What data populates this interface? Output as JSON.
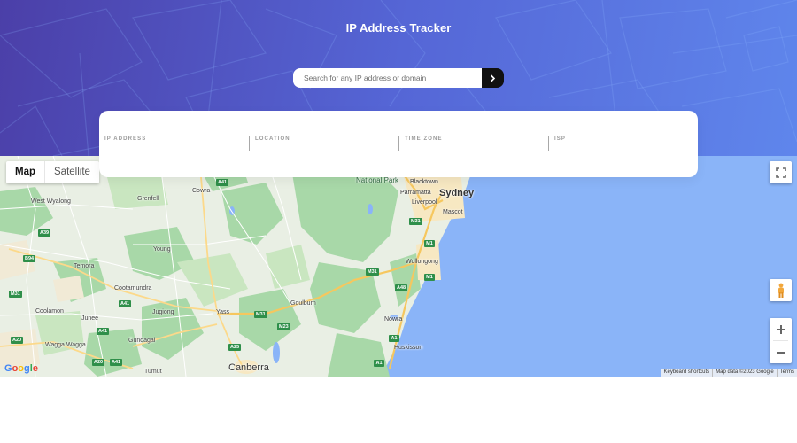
{
  "header": {
    "title": "IP Address Tracker"
  },
  "search": {
    "placeholder": "Search for any IP address or domain",
    "value": ""
  },
  "info": {
    "fields": [
      {
        "label": "IP ADDRESS",
        "value": ""
      },
      {
        "label": "LOCATION",
        "value": ""
      },
      {
        "label": "TIME ZONE",
        "value": ""
      },
      {
        "label": "ISP",
        "value": ""
      }
    ]
  },
  "map": {
    "type_control": {
      "map": "Map",
      "satellite": "Satellite",
      "selected": "Map"
    },
    "labels": {
      "national_park": "National Park",
      "blacktown": "Blacktown",
      "parramatta": "Parramatta",
      "sydney": "Sydney",
      "liverpool": "Liverpool",
      "mascot": "Mascot",
      "cowra": "Cowra",
      "west_wyalong": "West Wyalong",
      "grenfell": "Grenfell",
      "young": "Young",
      "temora": "Temora",
      "cootamundra": "Cootamundra",
      "coolamon": "Coolamon",
      "junee": "Junee",
      "jugiong": "Jugiong",
      "yass": "Yass",
      "goulburn": "Goulburn",
      "wagga_wagga": "Wagga Wagga",
      "gundagai": "Gundagai",
      "tumut": "Tumut",
      "canberra": "Canberra",
      "wollongong": "Wollongong",
      "nowra": "Nowra",
      "huskisson": "Huskisson"
    },
    "shields": [
      "A41",
      "M31",
      "M1",
      "M1",
      "M31",
      "A48",
      "M31",
      "M23",
      "A25",
      "A41",
      "A39",
      "B94",
      "A20",
      "A41",
      "A1",
      "A1",
      "M31",
      "A20",
      "A41"
    ],
    "attribution": {
      "shortcuts": "Keyboard shortcuts",
      "data": "Map data ©2023 Google",
      "terms": "Terms"
    },
    "logo": "Google",
    "colors": {
      "land": "#e9efe4",
      "forest": "#a8d8a8",
      "water": "#8ab4f8",
      "motorway": "#f6c75e"
    }
  }
}
